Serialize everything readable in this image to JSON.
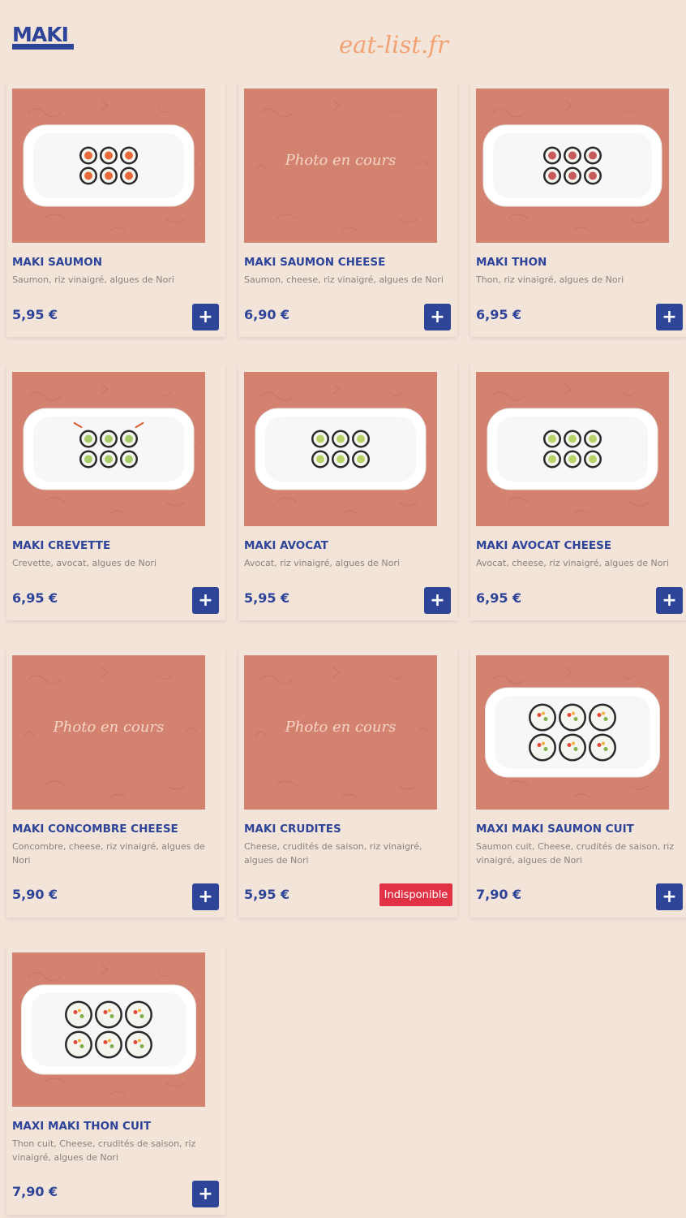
{
  "header": {
    "section_title": "MAKI",
    "watermark": "eat-list.fr"
  },
  "placeholder_text": "Photo en cours",
  "colors": {
    "accent": "#2d4499",
    "background": "#f3e4da",
    "image_bg": "#d3826f",
    "unavailable": "#e03145",
    "watermark": "#f2a272"
  },
  "products": [
    {
      "title": "MAKI SAUMON",
      "desc": "Saumon, riz vinaigré, algues de Nori",
      "price": "5,95 €",
      "available": true,
      "photo": "salmon-maki"
    },
    {
      "title": "MAKI SAUMON CHEESE",
      "desc": "Saumon, cheese, riz vinaigré, algues de Nori",
      "price": "6,90 €",
      "available": true,
      "photo": "placeholder"
    },
    {
      "title": "MAKI THON",
      "desc": "Thon, riz vinaigré, algues de Nori",
      "price": "6,95 €",
      "available": true,
      "photo": "tuna-maki"
    },
    {
      "title": "MAKI CREVETTE",
      "desc": "Crevette, avocat, algues de Nori",
      "price": "6,95 €",
      "available": true,
      "photo": "shrimp-maki"
    },
    {
      "title": "MAKI AVOCAT",
      "desc": "Avocat, riz vinaigré, algues de Nori",
      "price": "5,95 €",
      "available": true,
      "photo": "avocado-maki"
    },
    {
      "title": "MAKI AVOCAT CHEESE",
      "desc": "Avocat, cheese, riz vinaigré, algues de Nori",
      "price": "6,95 €",
      "available": true,
      "photo": "avocado-cheese-maki"
    },
    {
      "title": "MAKI CONCOMBRE CHEESE",
      "desc": "Concombre, cheese, riz vinaigré, algues de Nori",
      "price": "5,90 €",
      "available": true,
      "photo": "placeholder"
    },
    {
      "title": "MAKI CRUDITES",
      "desc": "Cheese, crudités de saison, riz vinaigré, algues de Nori",
      "price": "5,95 €",
      "available": false,
      "unavailable_label": "Indisponible",
      "photo": "placeholder"
    },
    {
      "title": "MAXI MAKI SAUMON CUIT",
      "desc": "Saumon cuit, Cheese, crudités de saison, riz vinaigré, algues de Nori",
      "price": "7,90 €",
      "available": true,
      "photo": "maxi-maki"
    },
    {
      "title": "MAXI MAKI THON CUIT",
      "desc": "Thon cuit, Cheese, crudités de saison, riz vinaigré, algues de Nori",
      "price": "7,90 €",
      "available": true,
      "photo": "maxi-maki"
    }
  ],
  "add_button_symbol": "+"
}
